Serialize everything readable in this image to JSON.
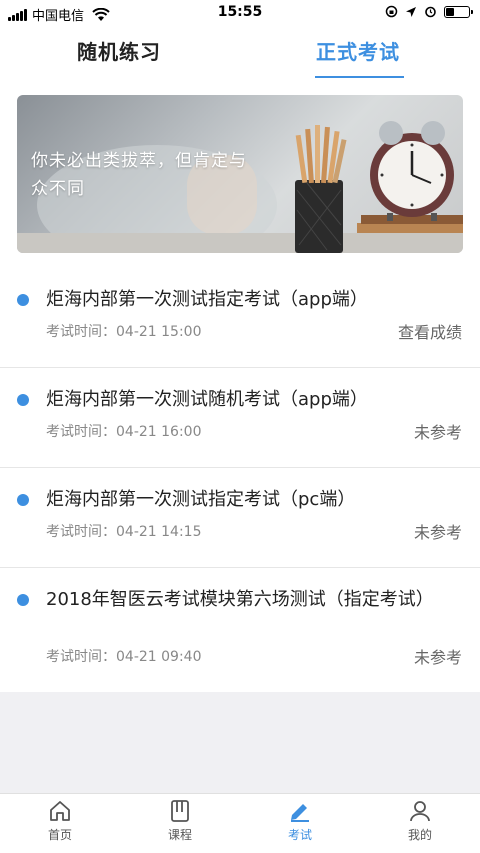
{
  "status_bar": {
    "carrier": "中国电信",
    "time": "15:55"
  },
  "tabs": [
    {
      "label": "随机练习",
      "active": false
    },
    {
      "label": "正式考试",
      "active": true
    }
  ],
  "banner": {
    "text": "你未必出类拔萃，但肯定与众不同"
  },
  "exams": [
    {
      "title": "炬海内部第一次测试指定考试（app端）",
      "time_label": "考试时间：04-21 15:00",
      "status": "查看成绩"
    },
    {
      "title": "炬海内部第一次测试随机考试（app端）",
      "time_label": "考试时间：04-21 16:00",
      "status": "未参考"
    },
    {
      "title": "炬海内部第一次测试指定考试（pc端）",
      "time_label": "考试时间：04-21 14:15",
      "status": "未参考"
    },
    {
      "title": "2018年智医云考试模块第六场测试（指定考试）",
      "time_label": "考试时间：04-21 09:40",
      "status": "未参考"
    }
  ],
  "bottom_nav": [
    {
      "label": "首页",
      "icon": "home-icon",
      "active": false
    },
    {
      "label": "课程",
      "icon": "book-icon",
      "active": false
    },
    {
      "label": "考试",
      "icon": "pen-icon",
      "active": true
    },
    {
      "label": "我的",
      "icon": "user-icon",
      "active": false
    }
  ],
  "colors": {
    "accent": "#3d8fe0",
    "background": "#f0f0f3"
  }
}
